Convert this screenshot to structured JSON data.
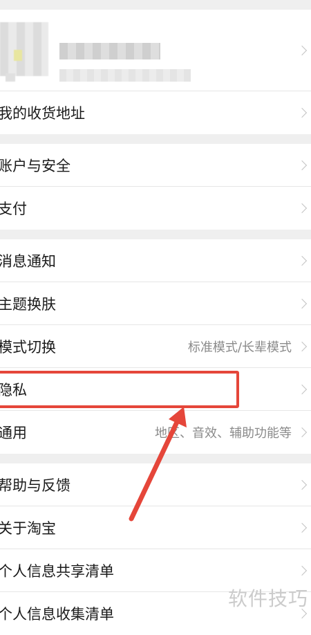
{
  "profile": {
    "chevron_icon": "chevron-right-icon"
  },
  "groups": [
    {
      "items": [
        {
          "label": "我的收货地址",
          "right": ""
        }
      ]
    },
    {
      "items": [
        {
          "label": "账户与安全",
          "right": ""
        },
        {
          "label": "支付",
          "right": ""
        }
      ]
    },
    {
      "items": [
        {
          "label": "消息通知",
          "right": ""
        },
        {
          "label": "主题换肤",
          "right": ""
        },
        {
          "label": "模式切换",
          "right": "标准模式/长辈模式"
        },
        {
          "label": "隐私",
          "right": ""
        },
        {
          "label": "通用",
          "right": "地区、音效、辅助功能等"
        }
      ]
    },
    {
      "items": [
        {
          "label": "帮助与反馈",
          "right": ""
        },
        {
          "label": "关于淘宝",
          "right": ""
        },
        {
          "label": "个人信息共享清单",
          "right": ""
        },
        {
          "label": "个人信息收集清单",
          "right": ""
        }
      ]
    }
  ],
  "annotation": {
    "color": "#e5463a",
    "highlighted_item": "隐私"
  },
  "watermark": "软件技巧"
}
